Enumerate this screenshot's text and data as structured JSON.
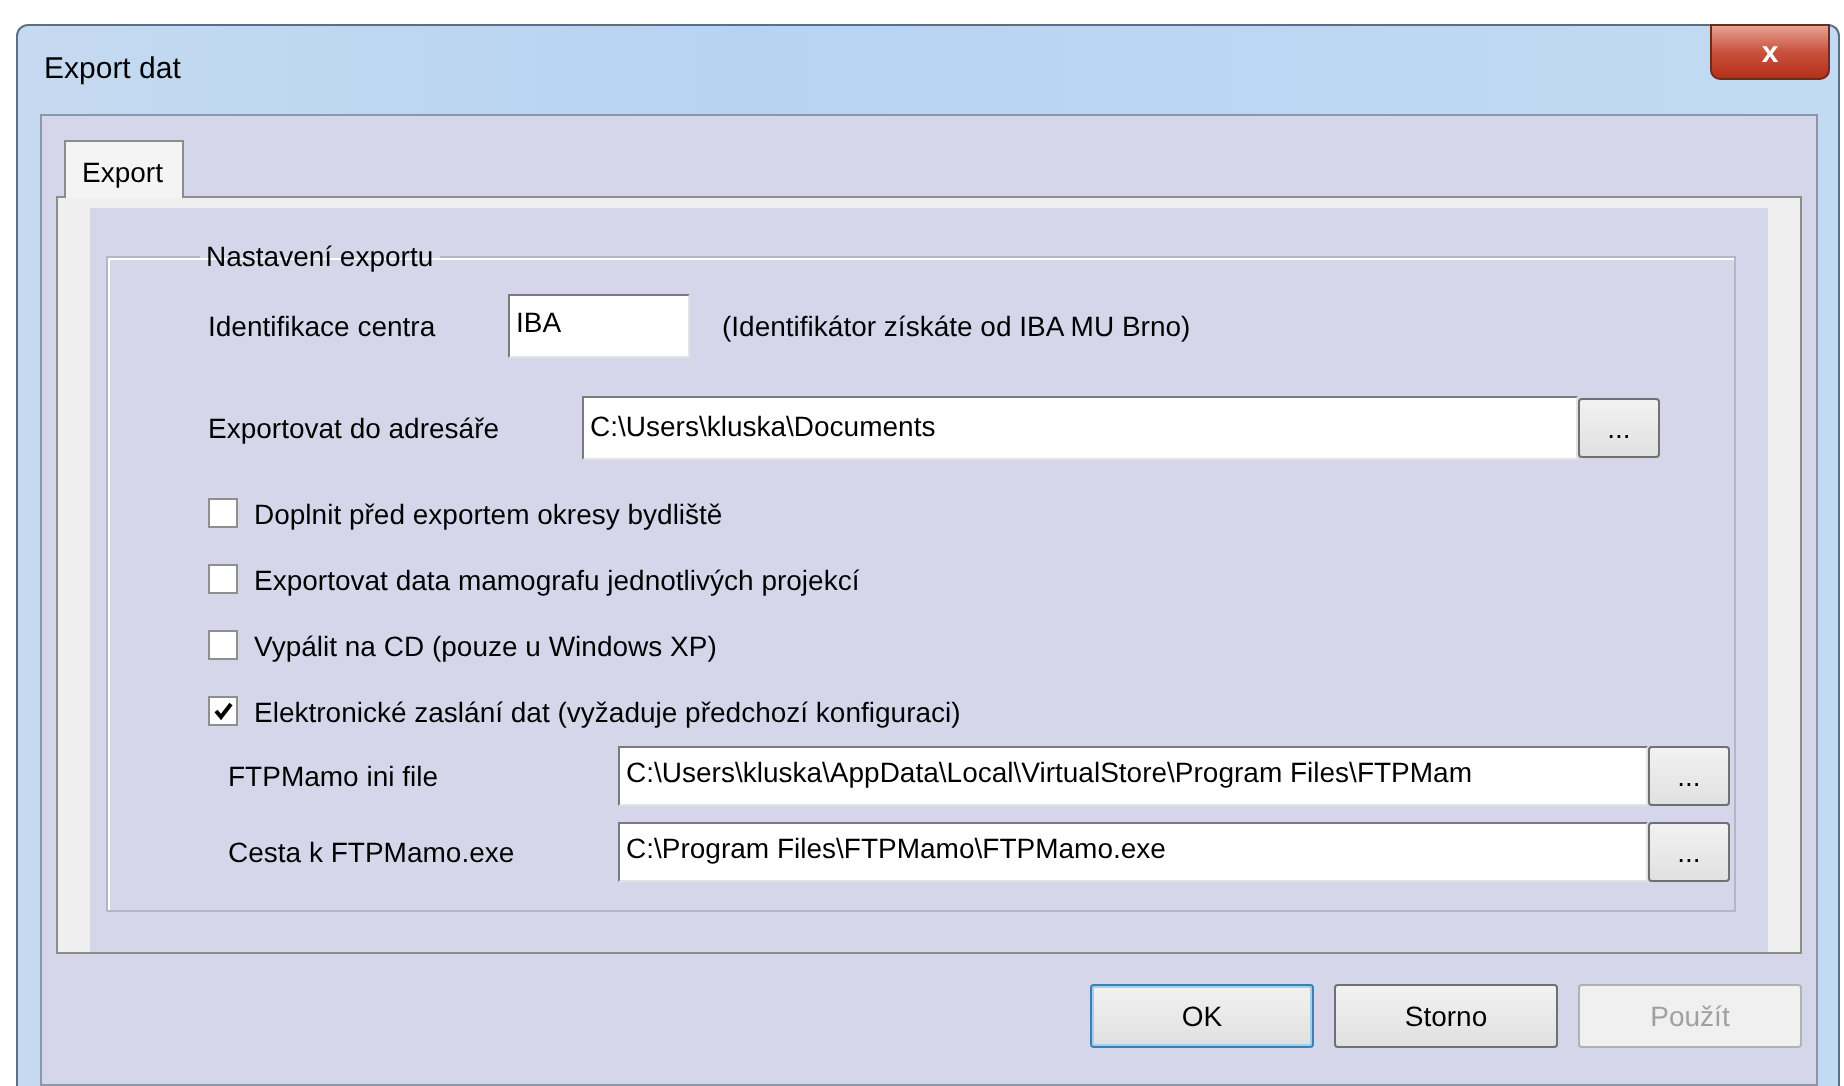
{
  "window": {
    "title": "Export dat",
    "close": "x"
  },
  "tabs": [
    {
      "label": "Export",
      "selected": true
    }
  ],
  "group": {
    "title": "Nastavení exportu",
    "center": {
      "label": "Identifikace centra",
      "value": "IBA",
      "hint": "(Identifikátor získáte od IBA MU Brno)"
    },
    "folder": {
      "label": "Exportovat do adresáře",
      "value": "C:\\Users\\kluska\\Documents",
      "browse": "..."
    },
    "options": [
      {
        "label": "Doplnit před exportem okresy bydliště",
        "checked": false
      },
      {
        "label": "Exportovat data mamografu jednotlivých projekcí",
        "checked": false
      },
      {
        "label": "Vypálit na CD (pouze u Windows XP)",
        "checked": false
      },
      {
        "label": "Elektronické zaslání dat (vyžaduje předchozí konfiguraci)",
        "checked": true
      }
    ],
    "paths": [
      {
        "label": "FTPMamo ini file",
        "value": "C:\\Users\\kluska\\AppData\\Local\\VirtualStore\\Program Files\\FTPMam",
        "browse": "..."
      },
      {
        "label": "Cesta k FTPMamo.exe",
        "value": "C:\\Program Files\\FTPMamo\\FTPMamo.exe",
        "browse": "..."
      }
    ]
  },
  "buttons": [
    {
      "label": "OK",
      "disabled": false,
      "default": true
    },
    {
      "label": "Storno",
      "disabled": false,
      "default": false
    },
    {
      "label": "Použít",
      "disabled": true,
      "default": false
    }
  ]
}
